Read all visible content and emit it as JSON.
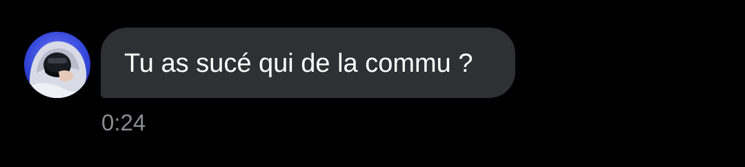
{
  "message": {
    "text": "Tu as sucé qui de la commu ?",
    "time": "0:24",
    "avatar_icon": "user-avatar",
    "bubble_color": "#2e3033",
    "background_color": "#000000",
    "timestamp_color": "#8a8d91"
  }
}
